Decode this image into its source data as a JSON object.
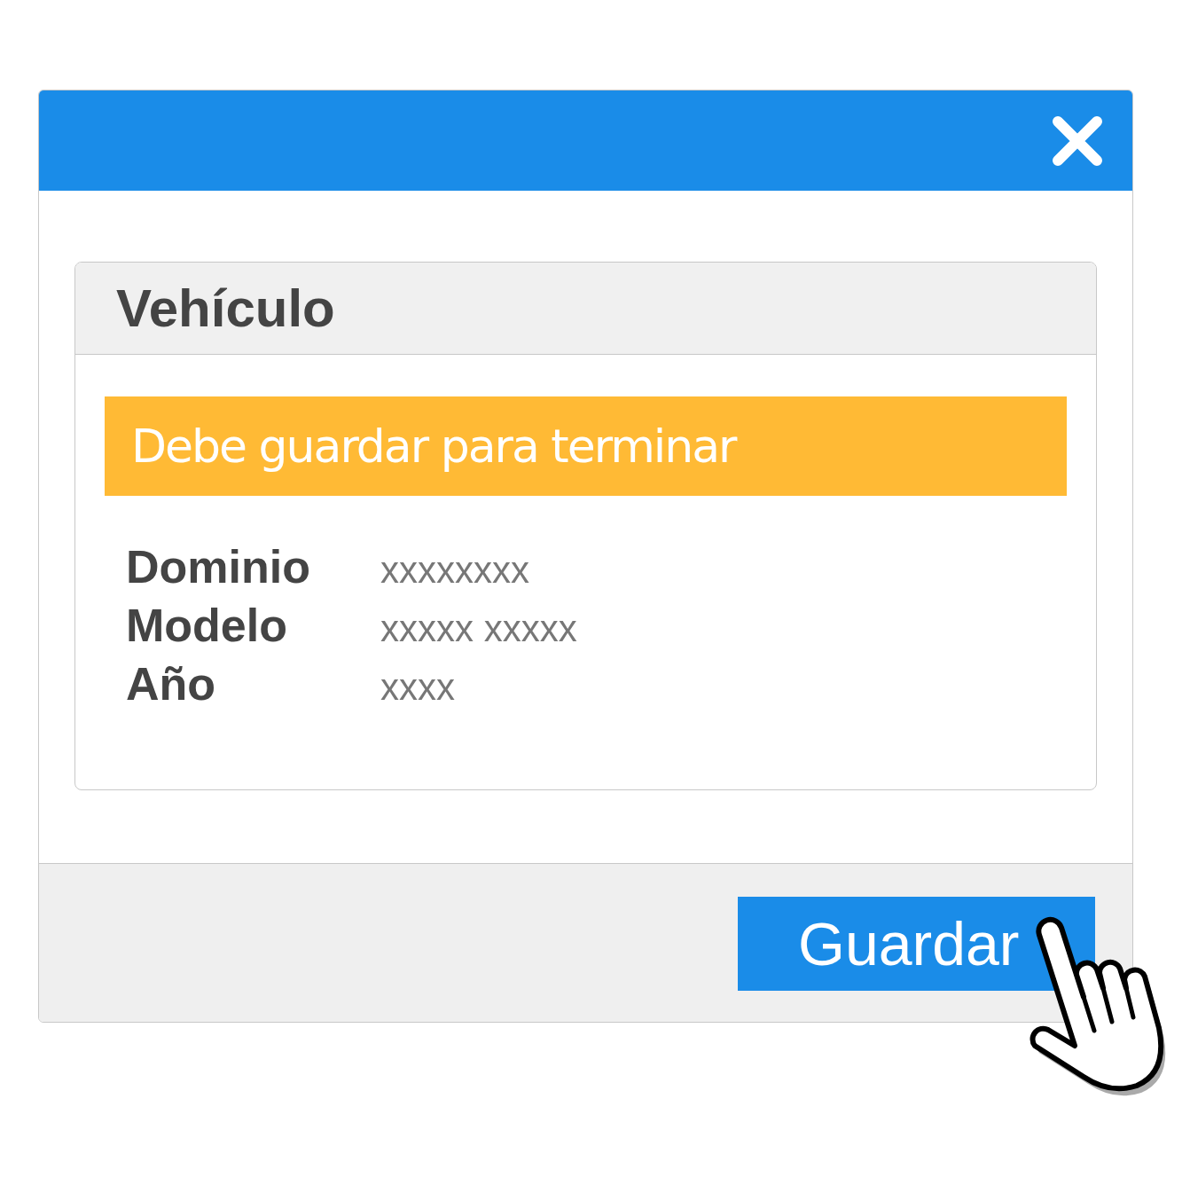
{
  "card": {
    "title": "Vehículo"
  },
  "alert": {
    "message": "Debe guardar para terminar"
  },
  "fields": [
    {
      "label": "Dominio",
      "value": "xxxxxxxx"
    },
    {
      "label": "Modelo",
      "value": "xxxxx xxxxx"
    },
    {
      "label": "Año",
      "value": "xxxx"
    }
  ],
  "footer": {
    "button": "Guardar"
  }
}
